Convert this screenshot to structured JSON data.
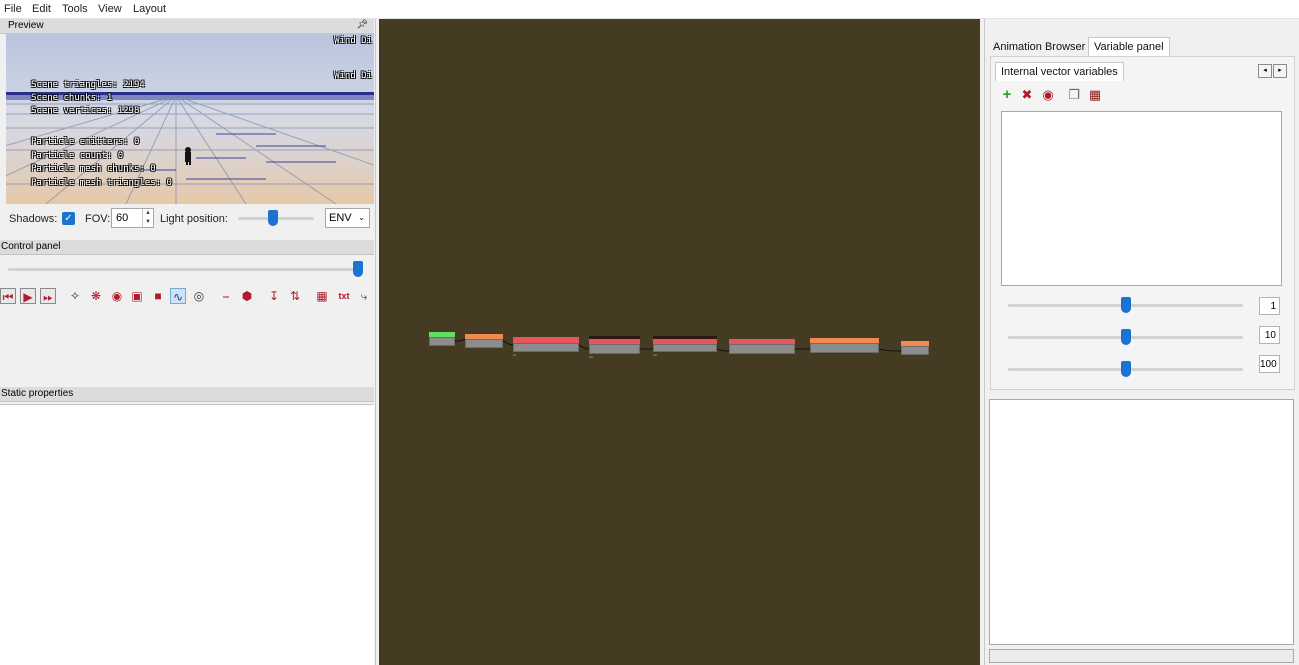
{
  "menu": [
    "File",
    "Edit",
    "Tools",
    "View",
    "Layout"
  ],
  "preview": {
    "title": "Preview",
    "pin_icon": "pin-icon",
    "hud_right": [
      "Wind Di",
      "Wind Di"
    ],
    "hud_scene": [
      "Scene triangles: 2194",
      "Scene chunks: 1",
      "Scene vertices: 1298"
    ],
    "hud_particles": [
      "Particle emitters: 0",
      "Particle count: 0",
      "Particle mesh chunks: 0",
      "Particle mesh triangles: 0"
    ],
    "shadows_label": "Shadows:",
    "shadows_checked": true,
    "fov_label": "FOV:",
    "fov_value": "60",
    "light_label": "Light position:",
    "light_level": 0.45,
    "env_value": "ENV"
  },
  "control_panel": {
    "title": "Control panel",
    "timeline_level": 1.0,
    "icons": [
      "skip-start-icon",
      "play-icon",
      "fast-forward-icon",
      "bone-icon",
      "bug-icon",
      "eye-icon",
      "camera-icon",
      "car-icon",
      "chart-icon",
      "target-icon",
      "ground-icon",
      "hexagon-icon",
      "arrow-down-icon",
      "arrows-updown-icon",
      "grid-icon"
    ],
    "txt_label": "txt"
  },
  "static_properties": {
    "title": "Static properties"
  },
  "right_panel": {
    "tabs": [
      "Animation Browser",
      "Variable panel"
    ],
    "selected_tab": 1,
    "subtab": "Internal vector variables",
    "nav_prev": "◂",
    "nav_next": "▸",
    "action_icons": [
      "add-icon",
      "delete-icon",
      "eye-icon",
      "copy-icon",
      "paste-icon"
    ],
    "sliders": [
      {
        "value": "1",
        "level": 0.5
      },
      {
        "value": "10",
        "level": 0.5
      },
      {
        "value": "100",
        "level": 0.5
      }
    ]
  },
  "colors": {
    "graph_bg": "#453b22",
    "accent": "#1a73d0",
    "node_green": "#5fe05f",
    "node_orange": "#f08a50",
    "node_red": "#e8555e"
  }
}
